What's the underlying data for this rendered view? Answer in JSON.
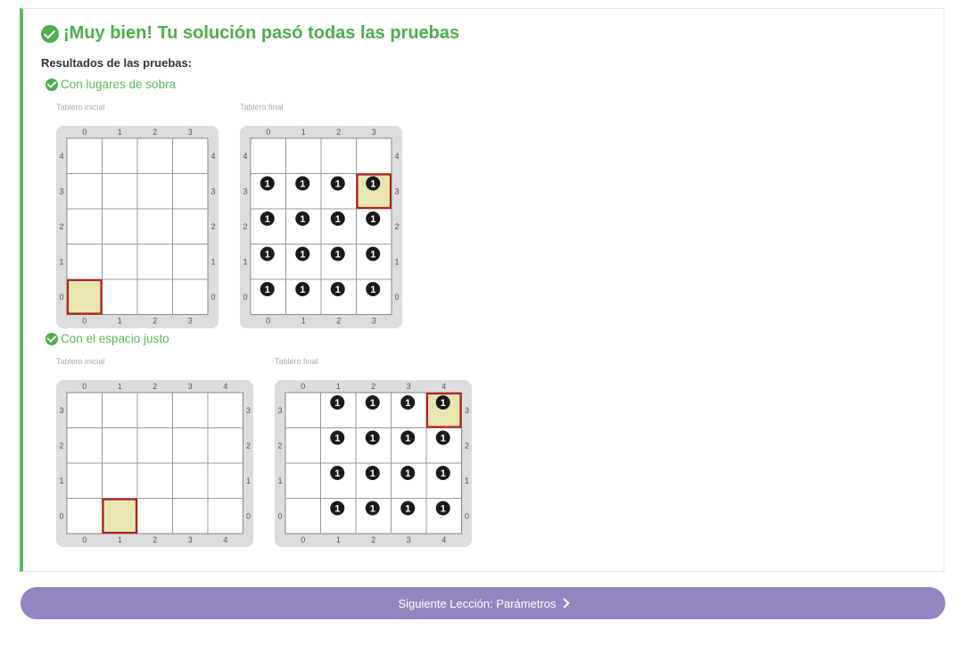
{
  "header": {
    "title": "¡Muy bien! Tu solución pasó todas las pruebas",
    "results_label": "Resultados de las pruebas:"
  },
  "tests": [
    {
      "name": "Con lugares de sobra",
      "initial": {
        "label": "Tablero inicial",
        "cols": 4,
        "rows": 5,
        "head": [
          0,
          0
        ],
        "balls": []
      },
      "final": {
        "label": "Tablero final",
        "cols": 4,
        "rows": 5,
        "head": [
          3,
          3
        ],
        "balls": [
          [
            0,
            0,
            1
          ],
          [
            1,
            0,
            1
          ],
          [
            2,
            0,
            1
          ],
          [
            3,
            0,
            1
          ],
          [
            0,
            1,
            1
          ],
          [
            1,
            1,
            1
          ],
          [
            2,
            1,
            1
          ],
          [
            3,
            1,
            1
          ],
          [
            0,
            2,
            1
          ],
          [
            1,
            2,
            1
          ],
          [
            2,
            2,
            1
          ],
          [
            3,
            2,
            1
          ],
          [
            0,
            3,
            1
          ],
          [
            1,
            3,
            1
          ],
          [
            2,
            3,
            1
          ],
          [
            3,
            3,
            1
          ]
        ]
      }
    },
    {
      "name": "Con el espacio justo",
      "initial": {
        "label": "Tablero inicial",
        "cols": 5,
        "rows": 4,
        "head": [
          1,
          0
        ],
        "balls": []
      },
      "final": {
        "label": "Tablero final",
        "cols": 5,
        "rows": 4,
        "head": [
          4,
          3
        ],
        "balls": [
          [
            1,
            0,
            1
          ],
          [
            2,
            0,
            1
          ],
          [
            3,
            0,
            1
          ],
          [
            4,
            0,
            1
          ],
          [
            1,
            1,
            1
          ],
          [
            2,
            1,
            1
          ],
          [
            3,
            1,
            1
          ],
          [
            4,
            1,
            1
          ],
          [
            1,
            2,
            1
          ],
          [
            2,
            2,
            1
          ],
          [
            3,
            2,
            1
          ],
          [
            4,
            2,
            1
          ],
          [
            1,
            3,
            1
          ],
          [
            2,
            3,
            1
          ],
          [
            3,
            3,
            1
          ],
          [
            4,
            3,
            1
          ]
        ]
      }
    }
  ],
  "next_button": {
    "label": "Siguiente Lección: Parámetros",
    "icon": "chevron-right-icon"
  },
  "colors": {
    "success": "#4cae4c",
    "head_border": "#b22222",
    "head_fill": "#e8e6b0",
    "button": "#9485c0",
    "ball": "#1a1a1a"
  }
}
